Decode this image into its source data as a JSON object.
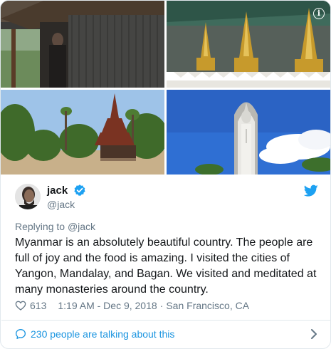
{
  "user": {
    "display_name": "jack",
    "handle": "@jack"
  },
  "reply": {
    "prefix": "Replying to",
    "to": "@jack"
  },
  "tweet": {
    "text": "Myanmar is an absolutely beautiful country. The people are full of joy and the food is amazing. I visited the cities of Yangon, Mandalay, and Bagan. We visited and meditated at many monasteries around the country."
  },
  "meta": {
    "likes": "613",
    "time": "1:19 AM - Dec 9, 2018",
    "separator": "·",
    "location": "San Francisco, CA"
  },
  "footer": {
    "talking": "230 people are talking about this"
  },
  "icons": {
    "info": "info-icon",
    "verified": "verified-badge-icon",
    "twitter": "twitter-bird-icon",
    "like": "heart-icon",
    "reply": "speech-bubble-icon",
    "chevron": "chevron-right-icon"
  },
  "colors": {
    "accent": "#1da1f2",
    "link": "#1b95e0",
    "muted": "#657786",
    "border": "#e1e8ed"
  }
}
